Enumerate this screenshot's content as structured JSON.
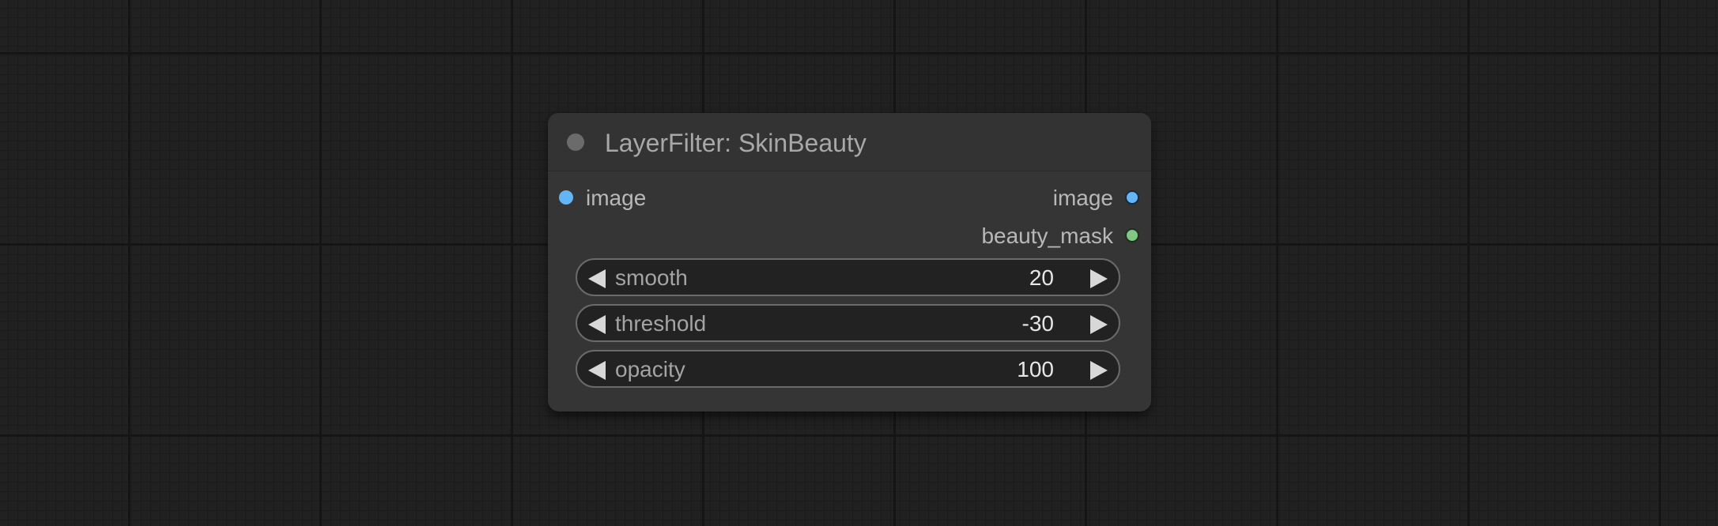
{
  "node": {
    "title": "LayerFilter: SkinBeauty",
    "inputs": [
      {
        "label": "image",
        "color": "#64b5f6"
      }
    ],
    "outputs": [
      {
        "label": "image",
        "color": "#64b5f6"
      },
      {
        "label": "beauty_mask",
        "color": "#81c784"
      }
    ],
    "widgets": [
      {
        "label": "smooth",
        "value": "20"
      },
      {
        "label": "threshold",
        "value": "-30"
      },
      {
        "label": "opacity",
        "value": "100"
      }
    ]
  },
  "icons": {
    "collapse": "collapse-dot-icon",
    "decrement": "arrow-left-icon",
    "increment": "arrow-right-icon"
  }
}
